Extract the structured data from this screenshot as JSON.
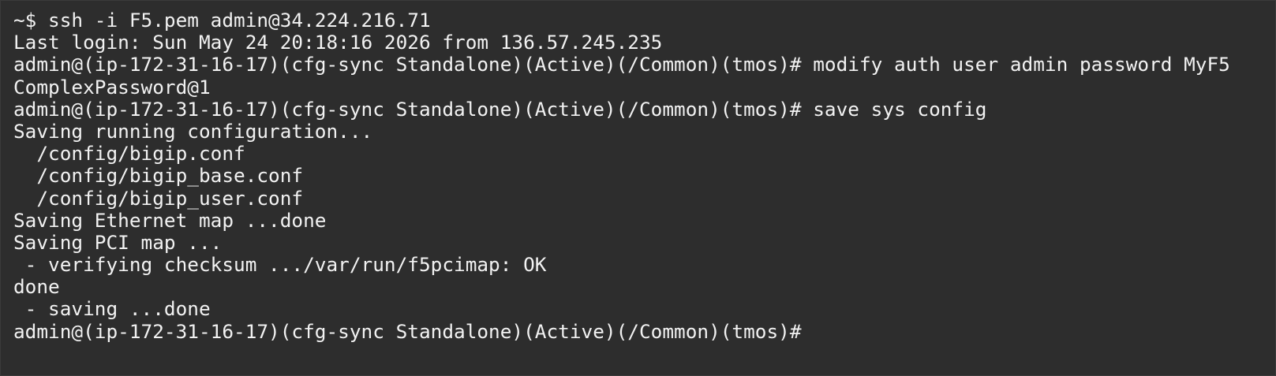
{
  "terminal": {
    "lines": [
      "~$ ssh -i F5.pem admin@34.224.216.71",
      "Last login: Sun May 24 20:18:16 2026 from 136.57.245.235",
      "admin@(ip-172-31-16-17)(cfg-sync Standalone)(Active)(/Common)(tmos)# modify auth user admin password MyF5",
      "ComplexPassword@1",
      "admin@(ip-172-31-16-17)(cfg-sync Standalone)(Active)(/Common)(tmos)# save sys config",
      "Saving running configuration...",
      "  /config/bigip.conf",
      "  /config/bigip_base.conf",
      "  /config/bigip_user.conf",
      "Saving Ethernet map ...done",
      "Saving PCI map ...",
      " - verifying checksum .../var/run/f5pcimap: OK",
      "done",
      " - saving ...done",
      "admin@(ip-172-31-16-17)(cfg-sync Standalone)(Active)(/Common)(tmos)# "
    ]
  },
  "colors": {
    "background": "#2d2d2d",
    "foreground": "#f2f2f2"
  }
}
